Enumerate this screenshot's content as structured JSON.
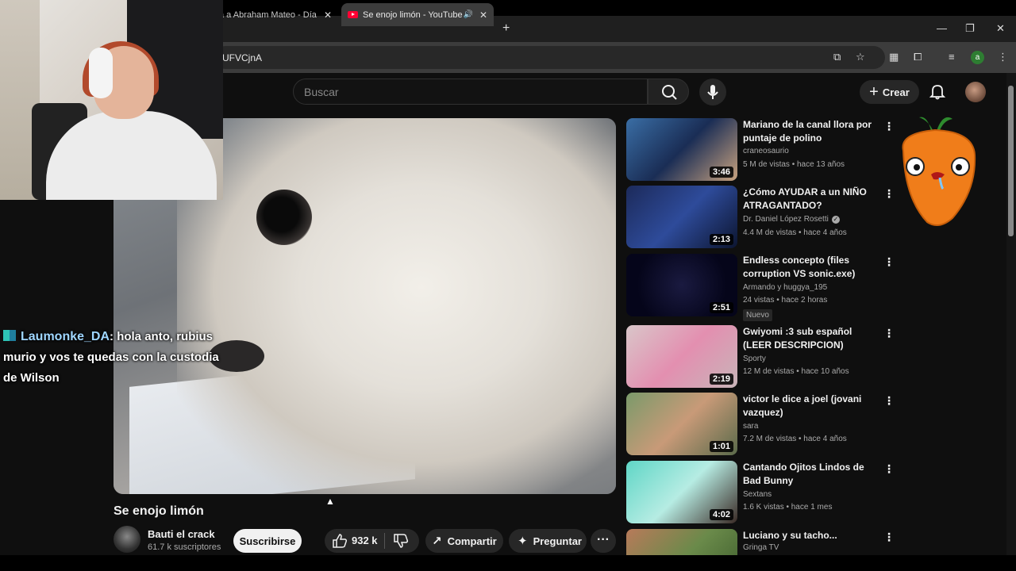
{
  "browser": {
    "tabs": [
      {
        "label": "a a Abraham Mateo - Día",
        "active": false
      },
      {
        "label": "Se enojo limón - YouTube",
        "active": true
      }
    ],
    "url": "UFVCjnA",
    "profile_initial": "a"
  },
  "youtube": {
    "search_placeholder": "Buscar",
    "create_label": "Crear",
    "video": {
      "title": "Se enojo limón",
      "channel": "Bauti el crack",
      "subscribers": "61.7 k suscriptores",
      "subscribe_label": "Suscribirse",
      "likes": "932 k",
      "share_label": "Compartir",
      "ask_label": "Preguntar"
    },
    "recommendations": [
      {
        "title": "Mariano de la canal llora por puntaje de polino",
        "channel": "craneosaurio",
        "meta": "5 M de vistas • hace 13 años",
        "duration": "3:46",
        "verified": false,
        "badge": ""
      },
      {
        "title": "¿Cómo AYUDAR a un NIÑO ATRAGANTADO?",
        "channel": "Dr. Daniel López Rosetti",
        "meta": "4.4 M de vistas • hace 4 años",
        "duration": "2:13",
        "verified": true,
        "badge": ""
      },
      {
        "title": "Endless concepto (files corruption VS sonic.exe)",
        "channel": "Armando y huggya_195",
        "meta": "24 vistas • hace 2 horas",
        "duration": "2:51",
        "verified": false,
        "badge": "Nuevo"
      },
      {
        "title": "Gwiyomi :3 sub español (LEER DESCRIPCION)",
        "channel": "Sporty",
        "meta": "12 M de vistas • hace 10 años",
        "duration": "2:19",
        "verified": false,
        "badge": ""
      },
      {
        "title": "victor le dice a joel (jovani vazquez)",
        "channel": "sara",
        "meta": "7.2 M de vistas • hace 4 años",
        "duration": "1:01",
        "verified": false,
        "badge": ""
      },
      {
        "title": "Cantando Ojitos Lindos de Bad Bunny",
        "channel": "Sextans",
        "meta": "1.6 K vistas • hace 1 mes",
        "duration": "4:02",
        "verified": false,
        "badge": ""
      },
      {
        "title": "Luciano y su tacho...",
        "channel": "Gringa TV",
        "meta": "",
        "duration": "",
        "verified": false,
        "badge": ""
      }
    ]
  },
  "chat": {
    "user": "Laumonke_DA",
    "message": ": hola anto, rubius murio y vos te quedas con la custodia de Wilson"
  },
  "colors": {
    "background": "#0f0f0f",
    "youtube_red": "#ff0033",
    "chip": "#272727",
    "chat_user": "#9fd6ff"
  }
}
